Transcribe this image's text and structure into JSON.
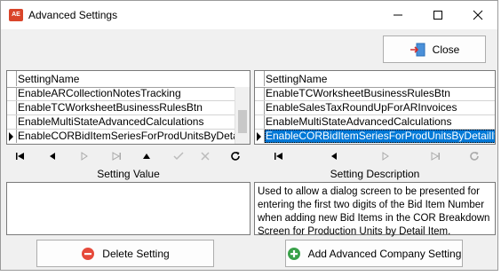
{
  "window": {
    "title": "Advanced Settings",
    "app_icon_text": "AE"
  },
  "close_button": {
    "label": "Close"
  },
  "left_grid": {
    "column_header": "SettingName",
    "rows": [
      "EnableARCollectionNotesTracking",
      "EnableTCWorksheetBusinessRulesBtn",
      "EnableMultiStateAdvancedCalculations",
      "EnableCORBidItemSeriesForProdUnitsByDetailItem"
    ],
    "current_row": 3
  },
  "right_grid": {
    "column_header": "SettingName",
    "rows": [
      "EnableTCWorksheetBusinessRulesBtn",
      "EnableSalesTaxRoundUpForARInvoices",
      "EnableMultiStateAdvancedCalculations",
      "EnableCORBidItemSeriesForProdUnitsByDetailItem"
    ],
    "current_row": 3
  },
  "setting_value": {
    "label": "Setting Value",
    "value": ""
  },
  "setting_description": {
    "label": "Setting Description",
    "text": "Used to allow a dialog screen to be presented for entering the first two digits of the Bid Item Number when adding new Bid Items in the COR Breakdown Screen for Production Units by Detail Item."
  },
  "delete_button": {
    "label": "Delete Setting",
    "icon_color": "#e64a3b"
  },
  "add_button": {
    "label": "Add Advanced Company Setting",
    "icon_color": "#3aa14a"
  },
  "colors": {
    "selection": "#0078d7"
  }
}
